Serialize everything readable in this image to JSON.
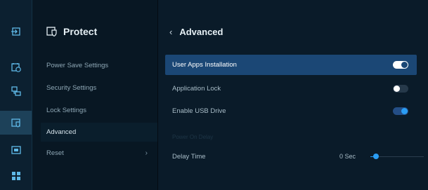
{
  "rail": {
    "items": [
      {
        "icon": "input-source-icon",
        "active": false
      },
      {
        "icon": "clock-settings-icon",
        "active": false
      },
      {
        "icon": "network-icon",
        "active": false
      },
      {
        "icon": "protect-icon",
        "active": true
      },
      {
        "icon": "display-icon",
        "active": false
      },
      {
        "icon": "apps-grid-icon",
        "active": false
      }
    ],
    "accent": "#5fb9e8"
  },
  "submenu": {
    "title": "Protect",
    "title_icon": "protect-icon",
    "items": [
      {
        "label": "Power Save Settings",
        "active": false,
        "has_arrow": false
      },
      {
        "label": "Security Settings",
        "active": false,
        "has_arrow": false
      },
      {
        "label": "Lock Settings",
        "active": false,
        "has_arrow": false
      },
      {
        "label": "Advanced",
        "active": true,
        "has_arrow": false
      },
      {
        "label": "Reset",
        "active": false,
        "has_arrow": true,
        "arrow": "›"
      }
    ]
  },
  "content": {
    "back_symbol": "‹",
    "title": "Advanced",
    "rows": [
      {
        "label": "User Apps Installation",
        "toggle": "on",
        "selected": true
      },
      {
        "label": "Application Lock",
        "toggle": "off",
        "selected": false
      },
      {
        "label": "Enable USB Drive",
        "toggle": "on",
        "selected": false
      }
    ],
    "section_label": "Power On Delay",
    "delay": {
      "label": "Delay Time",
      "value": "0 Sec",
      "level": 0.1
    }
  },
  "colors": {
    "selected_row": "#1b4775",
    "toggle_on": "#2a9df4",
    "background": "#050b12"
  }
}
